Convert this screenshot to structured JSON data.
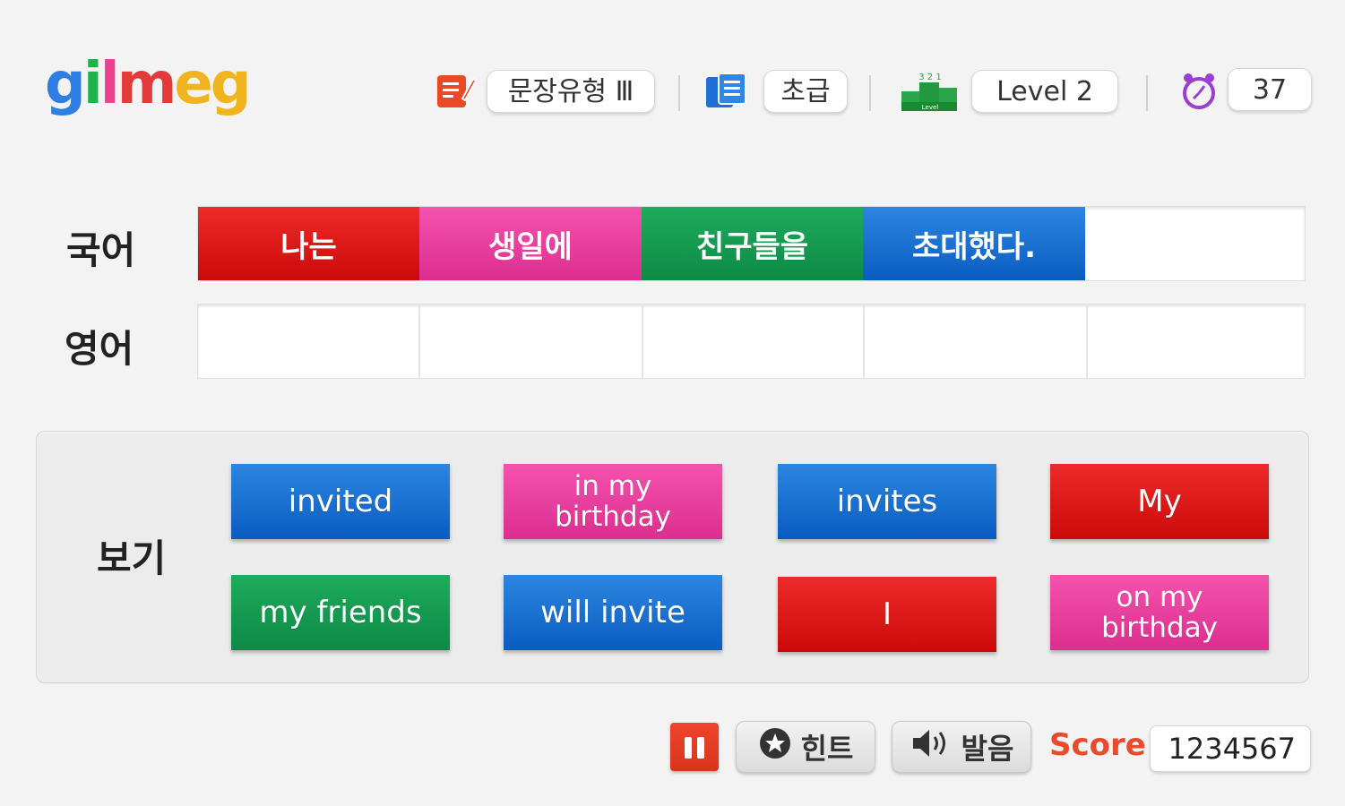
{
  "logo": {
    "letters": [
      {
        "ch": "g",
        "color": "#2f7ee6"
      },
      {
        "ch": "i",
        "color": "#1fb24b"
      },
      {
        "ch": "l",
        "color": "#ee3f8e"
      },
      {
        "ch": "m",
        "color": "#e53a3a"
      },
      {
        "ch": "e",
        "color": "#f0b41e"
      },
      {
        "ch": "g",
        "color": "#f0b41e"
      }
    ]
  },
  "header": {
    "sentence_type": "문장유형 Ⅲ",
    "grade": "초급",
    "level": "Level 2",
    "level_icon_text": "3 2 1",
    "level_icon_caption": "Level",
    "timer": "37"
  },
  "rows": {
    "korean_label": "국어",
    "english_label": "영어",
    "korean_words": [
      {
        "text": "나는",
        "color": "red"
      },
      {
        "text": "생일에",
        "color": "pink"
      },
      {
        "text": "친구들을",
        "color": "green"
      },
      {
        "text": "초대했다.",
        "color": "blue"
      },
      {
        "text": "",
        "color": "empty"
      }
    ],
    "english_slots": [
      "",
      "",
      "",
      "",
      ""
    ]
  },
  "choices": {
    "label": "보기",
    "cards": [
      {
        "text": "invited",
        "color": "blue"
      },
      {
        "text": "in my birthday",
        "color": "pink"
      },
      {
        "text": "invites",
        "color": "blue"
      },
      {
        "text": "My",
        "color": "red"
      },
      {
        "text": "my friends",
        "color": "green"
      },
      {
        "text": "will invite",
        "color": "blue"
      },
      {
        "text": "I",
        "color": "red"
      },
      {
        "text": "on my birthday",
        "color": "pink"
      }
    ]
  },
  "footer": {
    "hint_label": "힌트",
    "pronounce_label": "발음",
    "score_label": "Score",
    "score_value": "1234567"
  },
  "colors": {
    "red": "#dd1515",
    "pink": "#e83c9c",
    "green": "#129a4f",
    "blue": "#0f66c8",
    "score": "#ea4b2a"
  }
}
